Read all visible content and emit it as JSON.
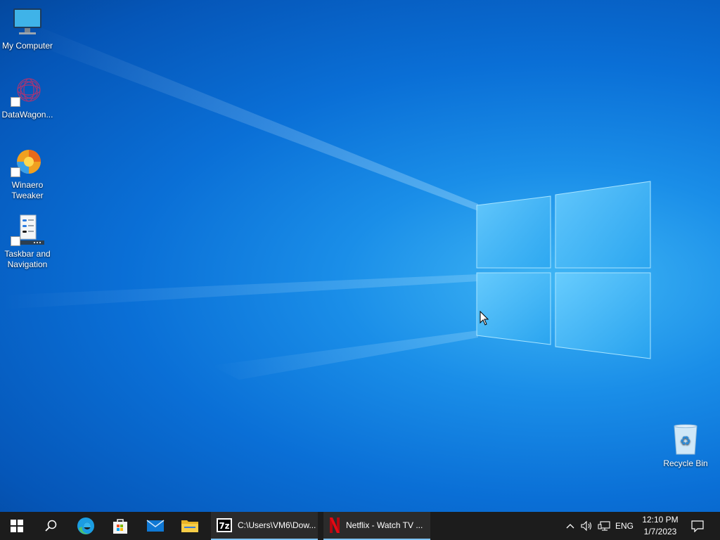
{
  "desktop": {
    "icons": [
      {
        "label": "My Computer",
        "icon": "monitor-icon"
      },
      {
        "label": "DataWagon...",
        "icon": "datawagon-icon"
      },
      {
        "label": "Winaero Tweaker",
        "icon": "winaero-tweaker-icon"
      },
      {
        "label": "Taskbar and Navigation",
        "icon": "taskbar-settings-icon"
      },
      {
        "label": "Recycle Bin",
        "icon": "recycle-bin-icon"
      }
    ]
  },
  "taskbar": {
    "start_icon": "windows-start-icon",
    "search_icon": "search-icon",
    "pinned": [
      "edge-icon",
      "store-icon",
      "mail-icon",
      "file-explorer-icon"
    ],
    "apps": [
      {
        "label": "C:\\Users\\VM6\\Dow...",
        "icon": "7zip-icon"
      },
      {
        "label": "Netflix - Watch TV ...",
        "icon": "netflix-icon"
      }
    ],
    "tray": {
      "overflow_icon": "chevron-up-icon",
      "volume_icon": "volume-icon",
      "network_icon": "network-icon",
      "language": "ENG",
      "time": "12:10 PM",
      "date": "1/7/2023",
      "notification_icon": "action-center-icon"
    }
  },
  "colors": {
    "accent": "#0a6fd6",
    "taskbar": "#1c1c1c",
    "active_underline": "#7fc4f5"
  }
}
